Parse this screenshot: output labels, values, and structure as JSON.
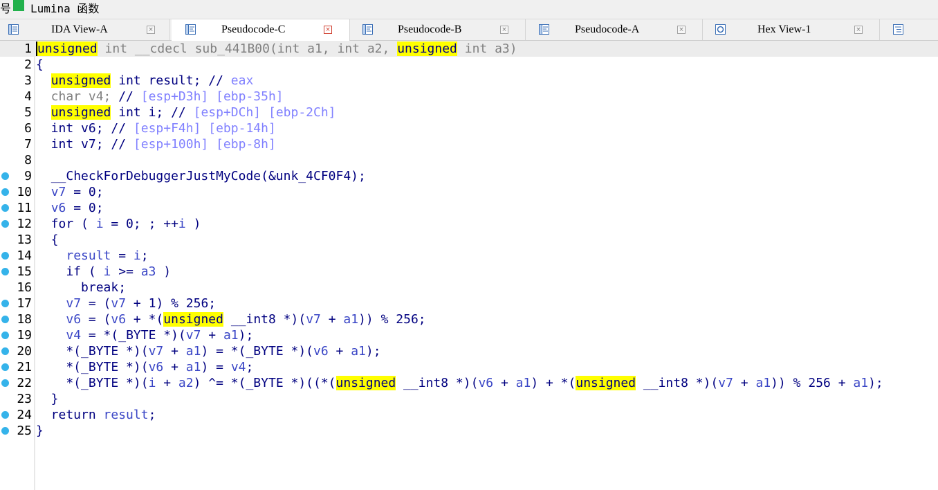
{
  "topbar": {
    "glyph": "号",
    "lumina_label": "Lumina 函数"
  },
  "tabs": [
    {
      "label": "IDA View-A",
      "icon": "disassembly-view-icon",
      "close": "×",
      "active": false
    },
    {
      "label": "Pseudocode-C",
      "icon": "pseudocode-icon",
      "close": "×",
      "active": true
    },
    {
      "label": "Pseudocode-B",
      "icon": "pseudocode-icon",
      "close": "×",
      "active": false
    },
    {
      "label": "Pseudocode-A",
      "icon": "pseudocode-icon",
      "close": "×",
      "active": false
    },
    {
      "label": "Hex View-1",
      "icon": "hex-view-icon",
      "close": "×",
      "active": false
    }
  ],
  "colors": {
    "keyword": "#000080",
    "variable": "#3a46c6",
    "comment": "#8080ff",
    "highlight": "#ffff00",
    "breakpoint_dot": "#35b3ea",
    "lumina": "#22b14c"
  },
  "editor": {
    "lines": [
      {
        "n": "1",
        "dot": false,
        "current": true,
        "segs": [
          [
            "unsigned",
            "hl cursor"
          ],
          [
            " int __cdecl sub_441B00(int a1, int a2, ",
            "gray"
          ],
          [
            "unsigned",
            "hl"
          ],
          [
            " int a3)",
            "gray"
          ]
        ]
      },
      {
        "n": "2",
        "dot": false,
        "segs": [
          [
            "{",
            "kw"
          ]
        ]
      },
      {
        "n": "3",
        "dot": false,
        "segs": [
          [
            "  ",
            ""
          ],
          [
            "unsigned",
            "hl"
          ],
          [
            " int result; // ",
            "kw"
          ],
          [
            "eax",
            "cmt"
          ]
        ]
      },
      {
        "n": "4",
        "dot": false,
        "segs": [
          [
            "  char v4; ",
            "gray"
          ],
          [
            "// ",
            "kw"
          ],
          [
            "[esp+D3h] [ebp-35h]",
            "cmt"
          ]
        ]
      },
      {
        "n": "5",
        "dot": false,
        "segs": [
          [
            "  ",
            ""
          ],
          [
            "unsigned",
            "hl"
          ],
          [
            " int i; // ",
            "kw"
          ],
          [
            "[esp+DCh] [ebp-2Ch]",
            "cmt"
          ]
        ]
      },
      {
        "n": "6",
        "dot": false,
        "segs": [
          [
            "  int v6; // ",
            "kw"
          ],
          [
            "[esp+F4h] [ebp-14h]",
            "cmt"
          ]
        ]
      },
      {
        "n": "7",
        "dot": false,
        "segs": [
          [
            "  int v7; // ",
            "kw"
          ],
          [
            "[esp+100h] [ebp-8h]",
            "cmt"
          ]
        ]
      },
      {
        "n": "8",
        "dot": false,
        "segs": []
      },
      {
        "n": "9",
        "dot": true,
        "segs": [
          [
            "  ",
            ""
          ],
          [
            "__CheckForDebuggerJustMyCode",
            "fn"
          ],
          [
            "(&unk_4CF0F4);",
            "kw"
          ]
        ]
      },
      {
        "n": "10",
        "dot": true,
        "segs": [
          [
            "  ",
            ""
          ],
          [
            "v7",
            "var"
          ],
          [
            " = 0;",
            "kw"
          ]
        ]
      },
      {
        "n": "11",
        "dot": true,
        "segs": [
          [
            "  ",
            ""
          ],
          [
            "v6",
            "var"
          ],
          [
            " = 0;",
            "kw"
          ]
        ]
      },
      {
        "n": "12",
        "dot": true,
        "segs": [
          [
            "  for ( ",
            "kw"
          ],
          [
            "i",
            "var"
          ],
          [
            " = 0; ; ++",
            "kw"
          ],
          [
            "i",
            "var"
          ],
          [
            " )",
            "kw"
          ]
        ]
      },
      {
        "n": "13",
        "dot": false,
        "segs": [
          [
            "  {",
            "kw"
          ]
        ]
      },
      {
        "n": "14",
        "dot": true,
        "segs": [
          [
            "    ",
            ""
          ],
          [
            "result",
            "var"
          ],
          [
            " = ",
            "kw"
          ],
          [
            "i",
            "var"
          ],
          [
            ";",
            "kw"
          ]
        ]
      },
      {
        "n": "15",
        "dot": true,
        "segs": [
          [
            "    if ( ",
            "kw"
          ],
          [
            "i",
            "var"
          ],
          [
            " >= ",
            "kw"
          ],
          [
            "a3",
            "var"
          ],
          [
            " )",
            "kw"
          ]
        ]
      },
      {
        "n": "16",
        "dot": false,
        "segs": [
          [
            "      break;",
            "kw"
          ]
        ]
      },
      {
        "n": "17",
        "dot": true,
        "segs": [
          [
            "    ",
            ""
          ],
          [
            "v7",
            "var"
          ],
          [
            " = (",
            "kw"
          ],
          [
            "v7",
            "var"
          ],
          [
            " + 1) % 256;",
            "kw"
          ]
        ]
      },
      {
        "n": "18",
        "dot": true,
        "segs": [
          [
            "    ",
            ""
          ],
          [
            "v6",
            "var"
          ],
          [
            " = (",
            "kw"
          ],
          [
            "v6",
            "var"
          ],
          [
            " + *(",
            "kw"
          ],
          [
            "unsigned",
            "hl"
          ],
          [
            " __int8 *)(",
            "kw"
          ],
          [
            "v7",
            "var"
          ],
          [
            " + ",
            "kw"
          ],
          [
            "a1",
            "var"
          ],
          [
            ")) % 256;",
            "kw"
          ]
        ]
      },
      {
        "n": "19",
        "dot": true,
        "segs": [
          [
            "    ",
            ""
          ],
          [
            "v4",
            "var"
          ],
          [
            " = *(_BYTE *)(",
            "kw"
          ],
          [
            "v7",
            "var"
          ],
          [
            " + ",
            "kw"
          ],
          [
            "a1",
            "var"
          ],
          [
            ");",
            "kw"
          ]
        ]
      },
      {
        "n": "20",
        "dot": true,
        "segs": [
          [
            "    *(_BYTE *)(",
            "kw"
          ],
          [
            "v7",
            "var"
          ],
          [
            " + ",
            "kw"
          ],
          [
            "a1",
            "var"
          ],
          [
            ") = *(_BYTE *)(",
            "kw"
          ],
          [
            "v6",
            "var"
          ],
          [
            " + ",
            "kw"
          ],
          [
            "a1",
            "var"
          ],
          [
            ");",
            "kw"
          ]
        ]
      },
      {
        "n": "21",
        "dot": true,
        "segs": [
          [
            "    *(_BYTE *)(",
            "kw"
          ],
          [
            "v6",
            "var"
          ],
          [
            " + ",
            "kw"
          ],
          [
            "a1",
            "var"
          ],
          [
            ") = ",
            "kw"
          ],
          [
            "v4",
            "var"
          ],
          [
            ";",
            "kw"
          ]
        ]
      },
      {
        "n": "22",
        "dot": true,
        "segs": [
          [
            "    *(_BYTE *)(",
            "kw"
          ],
          [
            "i",
            "var"
          ],
          [
            " + ",
            "kw"
          ],
          [
            "a2",
            "var"
          ],
          [
            ") ^= *(_BYTE *)((*(",
            "kw"
          ],
          [
            "unsigned",
            "hl"
          ],
          [
            " __int8 *)(",
            "kw"
          ],
          [
            "v6",
            "var"
          ],
          [
            " + ",
            "kw"
          ],
          [
            "a1",
            "var"
          ],
          [
            ") + *(",
            "kw"
          ],
          [
            "unsigned",
            "hl"
          ],
          [
            " __int8 *)(",
            "kw"
          ],
          [
            "v7",
            "var"
          ],
          [
            " + ",
            "kw"
          ],
          [
            "a1",
            "var"
          ],
          [
            ")) % 256 + ",
            "kw"
          ],
          [
            "a1",
            "var"
          ],
          [
            ");",
            "kw"
          ]
        ]
      },
      {
        "n": "23",
        "dot": false,
        "segs": [
          [
            "  }",
            "kw"
          ]
        ]
      },
      {
        "n": "24",
        "dot": true,
        "segs": [
          [
            "  return ",
            "kw"
          ],
          [
            "result",
            "var"
          ],
          [
            ";",
            "kw"
          ]
        ]
      },
      {
        "n": "25",
        "dot": true,
        "segs": [
          [
            "}",
            "kw"
          ]
        ]
      }
    ]
  }
}
